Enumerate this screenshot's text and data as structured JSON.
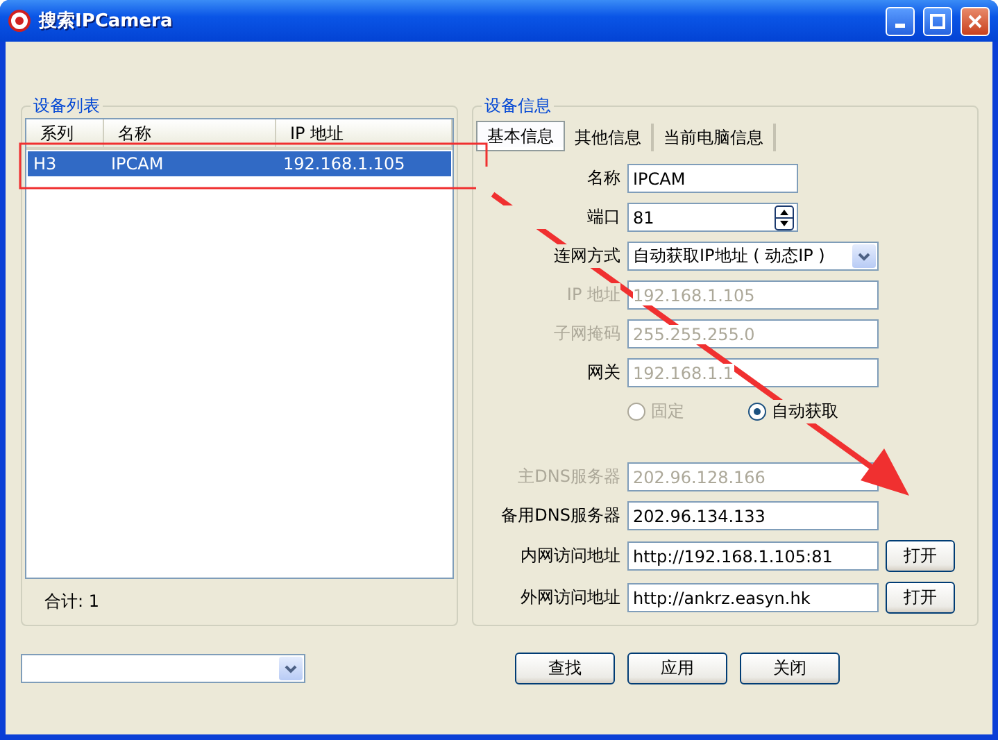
{
  "window": {
    "title": "搜索IPCamera"
  },
  "device_list": {
    "title": "设备列表",
    "columns": [
      "系列",
      "名称",
      "IP 地址"
    ],
    "rows": [
      {
        "cells": [
          "H3",
          "IPCAM",
          "192.168.1.105"
        ],
        "selected": true
      }
    ],
    "total": "合计: 1"
  },
  "device_info": {
    "title": "设备信息",
    "tabs": [
      {
        "label": "基本信息",
        "selected": true
      },
      {
        "label": "其他信息",
        "selected": false
      },
      {
        "label": "当前电脑信息",
        "selected": false
      }
    ],
    "fields": [
      {
        "kind": "text",
        "label": "名称",
        "value": "IPCAM",
        "label_disabled": false,
        "disabled": false
      },
      {
        "kind": "spinner",
        "label": "端口",
        "value": "81",
        "label_disabled": false,
        "disabled": false
      },
      {
        "kind": "select",
        "label": "连网方式",
        "value": "自动获取IP地址 ( 动态IP )",
        "label_disabled": false,
        "disabled": false
      },
      {
        "kind": "text",
        "label": "IP 地址",
        "value": "192.168.1.105",
        "label_disabled": true,
        "disabled": true
      },
      {
        "kind": "text",
        "label": "子网掩码",
        "value": "255.255.255.0",
        "label_disabled": true,
        "disabled": true
      },
      {
        "kind": "text",
        "label": "网关",
        "value": "192.168.1.1",
        "label_disabled": false,
        "disabled": true
      },
      {
        "kind": "radio",
        "options": [
          {
            "label": "固定",
            "selected": false,
            "disabled": true
          },
          {
            "label": "自动获取",
            "selected": true,
            "disabled": false
          }
        ]
      },
      {
        "kind": "text",
        "label": "主DNS服务器",
        "value": "202.96.128.166",
        "label_disabled": true,
        "disabled": true
      },
      {
        "kind": "text",
        "label": "备用DNS服务器",
        "value": "202.96.134.133",
        "label_disabled": false,
        "disabled": false
      },
      {
        "kind": "link",
        "label": "内网访问地址",
        "value": "http://192.168.1.105:81",
        "label_disabled": false,
        "disabled": false,
        "button": "打开"
      },
      {
        "kind": "link",
        "label": "外网访问地址",
        "value": "http://ankrz.easyn.hk",
        "label_disabled": false,
        "disabled": false,
        "button": "打开"
      }
    ]
  },
  "buttons": [
    "查找",
    "应用",
    "关闭"
  ]
}
